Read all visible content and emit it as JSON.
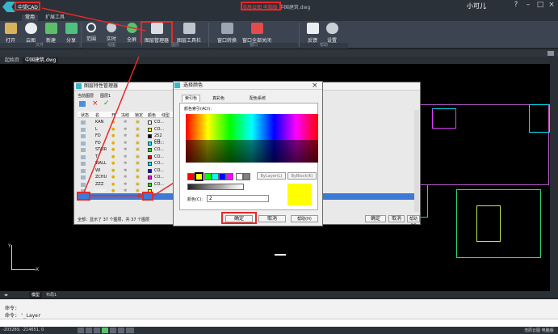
{
  "app": {
    "title": "中望CAD",
    "window_title_highlight": "浩辰云图 电脑版",
    "window_title_rest": "中国建筑.dwg",
    "user": "小可儿"
  },
  "ribbon_tabs": [
    "常用",
    "扩展工具"
  ],
  "ribbon": {
    "buttons": [
      "打开",
      "云图",
      "新建",
      "分享",
      "范围",
      "实时",
      "全屏",
      "图层管理器",
      "图层工具栏",
      "窗口转换",
      "窗口全部关闭",
      "反馈",
      "设置"
    ],
    "groups": [
      "文件",
      "视图",
      "图层",
      "窗口",
      "帮助"
    ]
  },
  "doc_tabs": [
    "起始页",
    "中国建筑.dwg"
  ],
  "layer_dialog": {
    "title": "图层特性管理器",
    "menu": [
      "当前图层",
      "图层1"
    ],
    "columns": [
      "状态",
      "名",
      "开",
      "冻结",
      "锁定",
      "颜色",
      "线型"
    ],
    "rows": [
      {
        "name": "KAN",
        "color": "CO..."
      },
      {
        "name": "L",
        "color": "CO..."
      },
      {
        "name": "FD",
        "color": "252 CO..."
      },
      {
        "name": "FD",
        "color": "CO..."
      },
      {
        "name": "STAIR",
        "color": "CO..."
      },
      {
        "name": "T",
        "color": "CO..."
      },
      {
        "name": "WALL",
        "color": "CO..."
      },
      {
        "name": "WI",
        "color": "CO..."
      },
      {
        "name": "ZCHU",
        "color": "CO..."
      },
      {
        "name": "ZZZ",
        "color": "CO..."
      },
      {
        "name": "Layer",
        "color": "CO..."
      },
      {
        "name": "建",
        "color": "CO..."
      }
    ],
    "status_text": "全部：显示了 37 个图层，共 37 个图层",
    "ok": "确定",
    "cancel": "取消",
    "help": "帮助(H)"
  },
  "color_dialog": {
    "title": "选择颜色",
    "tabs": [
      "索引色",
      "真彩色",
      "配色系统"
    ],
    "aci_label": "颜色索引(ACI):",
    "bylayer": "ByLayer(L)",
    "byblock": "ByBlock(K)",
    "color_label": "颜色(C):",
    "color_value": "2",
    "ok": "确定",
    "cancel": "取消",
    "help": "帮助(H)",
    "preview_color": "#ffff00"
  },
  "layout_tabs": [
    "模型",
    "布局1"
  ],
  "command": {
    "line1": "命令:",
    "line2": "命令: '_Layer"
  },
  "status": {
    "coords": "-203289, -214651, 0",
    "right": "浩辰云图 电脑版"
  },
  "colors": {
    "accent_red": "#e42a2a",
    "selected_row": "#3d7ad8"
  }
}
